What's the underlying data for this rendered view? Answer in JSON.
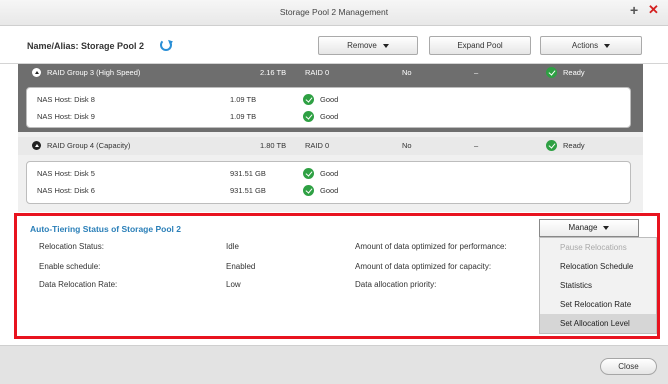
{
  "window": {
    "title": "Storage Pool 2 Management"
  },
  "header": {
    "name_label": "Name/Alias: Storage Pool 2",
    "remove_label": "Remove",
    "expand_label": "Expand Pool",
    "actions_label": "Actions"
  },
  "groups": [
    {
      "name": "RAID Group 3 (High Speed)",
      "capacity": "2.16 TB",
      "raid": "RAID 0",
      "flag": "No",
      "dash": "–",
      "status": "Ready",
      "disks": [
        {
          "name": "NAS Host: Disk 8",
          "capacity": "1.09 TB",
          "status": "Good"
        },
        {
          "name": "NAS Host: Disk 9",
          "capacity": "1.09 TB",
          "status": "Good"
        }
      ]
    },
    {
      "name": "RAID Group 4 (Capacity)",
      "capacity": "1.80 TB",
      "raid": "RAID 0",
      "flag": "No",
      "dash": "–",
      "status": "Ready",
      "disks": [
        {
          "name": "NAS Host: Disk 5",
          "capacity": "931.51 GB",
          "status": "Good"
        },
        {
          "name": "NAS Host: Disk 6",
          "capacity": "931.51 GB",
          "status": "Good"
        }
      ]
    }
  ],
  "tiering": {
    "title": "Auto-Tiering Status of Storage Pool 2",
    "rows": [
      {
        "label": "Relocation Status:",
        "value": "Idle"
      },
      {
        "label": "Enable schedule:",
        "value": "Enabled"
      },
      {
        "label": "Data Relocation Rate:",
        "value": "Low"
      }
    ],
    "right_labels": [
      "Amount of data optimized for performance:",
      "Amount of data optimized for capacity:",
      "Data allocation priority:"
    ],
    "manage_label": "Manage",
    "menu": [
      {
        "label": "Pause Relocations",
        "disabled": true
      },
      {
        "label": "Relocation Schedule"
      },
      {
        "label": "Statistics"
      },
      {
        "label": "Set Relocation Rate"
      },
      {
        "label": "Set Allocation Level",
        "hover": true
      }
    ]
  },
  "footer": {
    "close_label": "Close"
  },
  "colors": {
    "accent": "#2a7fb8",
    "highlight_frame": "#e8131f",
    "good": "#2ea043"
  }
}
